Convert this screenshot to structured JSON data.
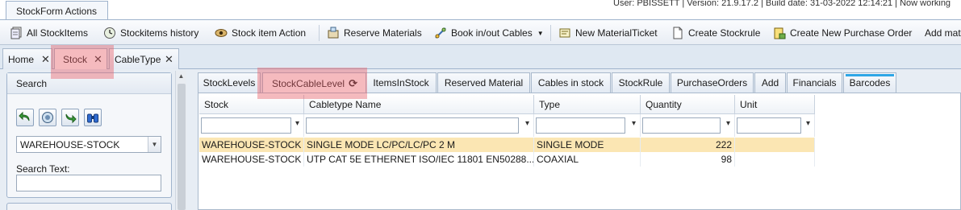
{
  "ribbon": {
    "tab_label": "StockForm Actions"
  },
  "status_line": "User: PBISSETT | Version: 21.9.17.2 | Build date: 31-03-2022 12:14:21 | Now working",
  "toolbar": {
    "items": [
      {
        "label": "All StockItems",
        "icon": "documents-icon"
      },
      {
        "label": "Stockitems history",
        "icon": "history-clock-icon"
      },
      {
        "label": "Stock item Action",
        "icon": "action-eye-icon"
      },
      {
        "label": "Reserve Materials",
        "icon": "reserve-icon"
      },
      {
        "label": "Book in/out Cables",
        "icon": "cable-icon",
        "dropdown": "▼"
      },
      {
        "label": "New MaterialTicket",
        "icon": "ticket-icon"
      },
      {
        "label": "Create Stockrule",
        "icon": "page-icon"
      },
      {
        "label": "Create New Purchase Order",
        "icon": "purchase-order-icon"
      },
      {
        "label": "Add mat",
        "icon": ""
      }
    ]
  },
  "doc_tabs": [
    {
      "label": "Home",
      "close": "✕"
    },
    {
      "label": "Stock",
      "close": "✕",
      "active": true
    },
    {
      "label": "CableType",
      "close": "✕"
    }
  ],
  "search": {
    "title": "Search",
    "location_value": "WAREHOUSE-STOCK",
    "dropdown_arrow": "▼",
    "search_text_label": "Search Text:",
    "search_text_value": ""
  },
  "sub_tabs": [
    {
      "label": "StockLevels"
    },
    {
      "label": "StockCableLevel",
      "active": true,
      "refresh": "⟳"
    },
    {
      "label": "ItemsInStock"
    },
    {
      "label": "Reserved Material"
    },
    {
      "label": "Cables in stock"
    },
    {
      "label": "StockRule"
    },
    {
      "label": "PurchaseOrders"
    },
    {
      "label": "Add"
    },
    {
      "label": "Financials"
    },
    {
      "label": "Barcodes"
    }
  ],
  "grid": {
    "columns": [
      "Stock",
      "Cabletype Name",
      "Type",
      "Quantity",
      "Unit"
    ],
    "filter_glyph": "▾",
    "rows": [
      {
        "stock": "WAREHOUSE-STOCK",
        "cabletype": "SINGLE MODE LC/PC/LC/PC 2 M",
        "type": "SINGLE MODE",
        "quantity": "222",
        "unit": "",
        "selected": true
      },
      {
        "stock": "WAREHOUSE-STOCK",
        "cabletype": "UTP CAT 5E ETHERNET ISO/IEC 11801 EN50288...",
        "type": "COAXIAL",
        "quantity": "98",
        "unit": ""
      }
    ]
  },
  "colors": {
    "highlight": "#e85a64",
    "selected_row": "#fbe6b3",
    "accent_bar": "#2ea6e6"
  }
}
